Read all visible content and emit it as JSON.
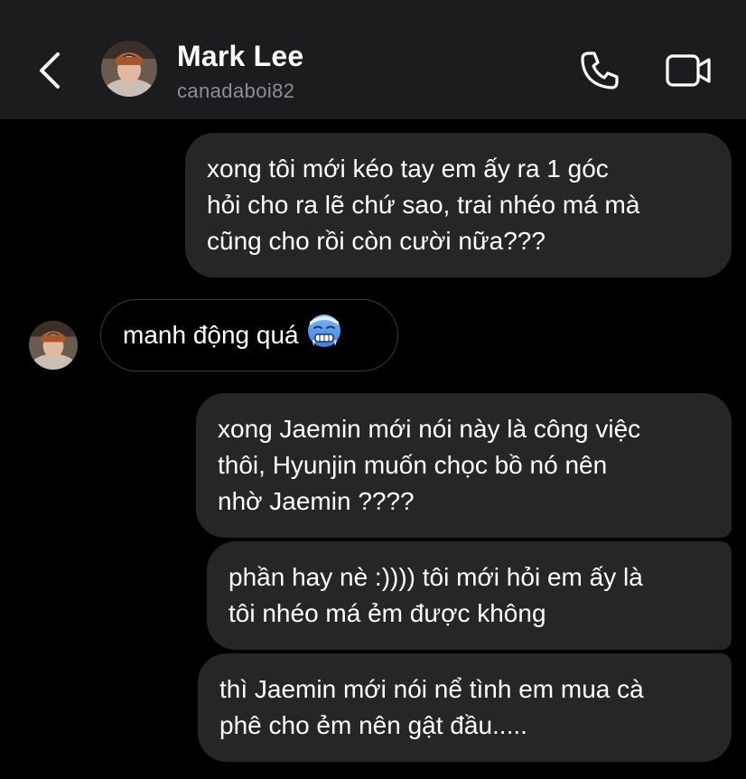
{
  "header": {
    "name": "Mark Lee",
    "handle": "canadaboi82"
  },
  "messages": [
    {
      "direction": "outgoing",
      "lines": [
        "xong tôi mới kéo tay em ấy ra 1 góc",
        "hỏi cho ra lẽ chứ sao, trai nhéo má mà",
        "cũng cho rồi còn cười nữa???"
      ]
    },
    {
      "direction": "incoming",
      "lines": [
        "manh động quá"
      ],
      "emoji": "cold-face-icon"
    },
    {
      "direction": "outgoing",
      "lines": [
        "xong Jaemin mới nói này là công việc",
        "thôi, Hyunjin muốn chọc bồ nó nên",
        "nhờ Jaemin ????"
      ]
    },
    {
      "direction": "outgoing",
      "lines": [
        "phần hay nè :)))) tôi mới hỏi em ấy là",
        "tôi nhéo má ẻm được không"
      ]
    },
    {
      "direction": "outgoing",
      "lines": [
        "thì Jaemin mới nói nể tình em mua cà",
        "phê cho ẻm nên gật đầu....."
      ]
    }
  ],
  "colors": {
    "background": "#000000",
    "header_bg": "#1c1c1e",
    "outgoing_bubble": "#262628",
    "incoming_border": "#3a3a3c",
    "handle_text": "#8e8e93"
  }
}
